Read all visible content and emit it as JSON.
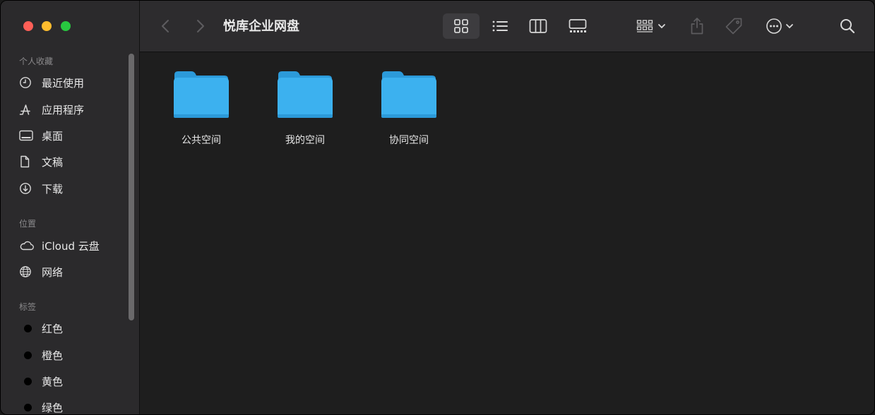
{
  "window": {
    "title": "悦库企业网盘"
  },
  "sidebar": {
    "favorites_title": "个人收藏",
    "favorites": [
      {
        "label": "最近使用",
        "icon": "clock-icon"
      },
      {
        "label": "应用程序",
        "icon": "apps-icon"
      },
      {
        "label": "桌面",
        "icon": "desktop-icon"
      },
      {
        "label": "文稿",
        "icon": "document-icon"
      },
      {
        "label": "下载",
        "icon": "download-icon"
      }
    ],
    "locations_title": "位置",
    "locations": [
      {
        "label": "iCloud 云盘",
        "icon": "cloud-icon"
      },
      {
        "label": "网络",
        "icon": "globe-icon"
      }
    ],
    "tags_title": "标签",
    "tags": [
      {
        "label": "红色",
        "color": "#000000"
      },
      {
        "label": "橙色",
        "color": "#000000"
      },
      {
        "label": "黄色",
        "color": "#000000"
      },
      {
        "label": "绿色",
        "color": "#000000"
      }
    ]
  },
  "toolbar": {
    "view_mode": "icon",
    "icons": [
      "back-icon",
      "forward-icon",
      "grid-view-icon",
      "list-view-icon",
      "column-view-icon",
      "gallery-view-icon",
      "group-icon",
      "share-icon",
      "tag-icon",
      "more-icon",
      "search-icon"
    ]
  },
  "content": {
    "folders": [
      {
        "name": "公共空间"
      },
      {
        "name": "我的空间"
      },
      {
        "name": "协同空间"
      }
    ]
  },
  "colors": {
    "folder": "#3cb1ef",
    "folder_tab": "#2c9ad9",
    "sidebar_bg": "#2b2a2c",
    "content_bg": "#1e1e1e"
  }
}
